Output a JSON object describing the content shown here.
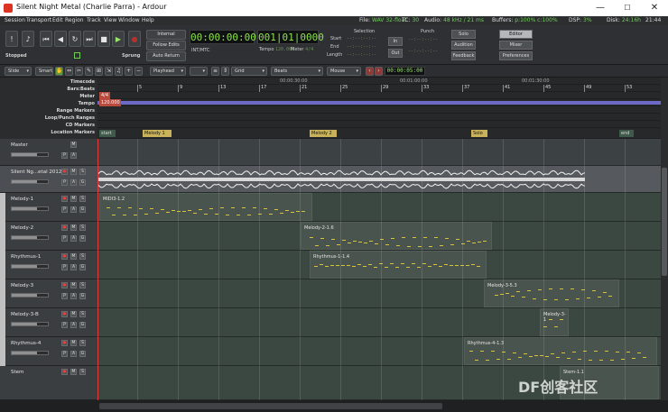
{
  "window": {
    "title": "Silent Night Metal (Charlie Parra) - Ardour",
    "minimize": "—",
    "maximize": "☐",
    "close": "✕"
  },
  "menu": [
    "Session",
    "Transport",
    "Edit",
    "Region",
    "Track",
    "View",
    "Window",
    "Help"
  ],
  "status": {
    "file_label": "File:",
    "file_value": "WAV 32-float",
    "tc_label": "TC:",
    "tc_value": "30",
    "audio_label": "Audio:",
    "audio_value": "48 kHz / 21 ms",
    "buffers_label": "Buffers:",
    "buffers_value": "p:100% c:100%",
    "dsp_label": "DSP:",
    "dsp_value": "3%",
    "disk_label": "Disk:",
    "disk_value": "24:16h",
    "time": "21:44"
  },
  "transport": {
    "status": "Stopped",
    "sprung": "Sprung",
    "internal": "Internal",
    "follow_edits": "Follow Edits",
    "auto_return": "Auto Return",
    "int_mtc": "INT/MTC",
    "primary_clock": "00:00:00:00",
    "secondary_clock": "001|01|0000",
    "tempo_label": "Tempo",
    "tempo_value": "120.000",
    "meter_label": "Meter",
    "meter_value": "4/4",
    "selection": "Selection",
    "start": "Start",
    "end": "End",
    "length": "Length",
    "sel_start": "--:--:--:--",
    "sel_end": "--:--:--:--",
    "sel_length": "--:--:--:--",
    "punch": "Punch",
    "in": "In",
    "out": "Out",
    "punch_in": "--:--:--:--",
    "punch_out": "--:--:--:--",
    "solo": "Solo",
    "audition": "Audition",
    "feedback": "Feedback",
    "editor": "Editor",
    "mixer": "Mixer",
    "preferences": "Preferences"
  },
  "toolbar": {
    "edit_mode": "Slide",
    "ripple": "Smart",
    "edit_point": "Playhead",
    "snap": "Grid",
    "grid": "Beats",
    "edit_target": "Mouse",
    "nudge_clock": "00:00:05:00"
  },
  "ruler_labels": [
    "Timecode",
    "Bars:Beats",
    "Meter",
    "Tempo",
    "Range Markers",
    "Loop/Punch Ranges",
    "CD Markers",
    "Location Markers"
  ],
  "ruler_values": {
    "meter_marker": "4/4",
    "tempo_marker": "120.000",
    "tc1": "00:00:30:00",
    "tc2": "00:01:00:00",
    "tc3": "00:01:30:00",
    "bars": [
      "5",
      "9",
      "13",
      "17",
      "21",
      "25",
      "29",
      "33",
      "37",
      "41",
      "45",
      "49",
      "53"
    ]
  },
  "locations": [
    "start",
    "Melody 1",
    "Melody 2",
    "Solo",
    "end"
  ],
  "tracks": [
    {
      "name": "Master"
    },
    {
      "name": "Silent Ng...etal 2012"
    },
    {
      "name": "Melody-1"
    },
    {
      "name": "Melody-2"
    },
    {
      "name": "Rhythmus-1"
    },
    {
      "name": "Melody-3"
    },
    {
      "name": "Melody-3-B"
    },
    {
      "name": "Rhythmus-4"
    },
    {
      "name": "Stem"
    }
  ],
  "regions": [
    "MIDI3-1.2",
    "Melody-2-1.6",
    "Rhythmus-1-1.4",
    "Melody-3-5.3",
    "Melody-3-1",
    "Rhythmus-4-1.3",
    "Stem-1.1"
  ],
  "watermark": "DF创客社区"
}
